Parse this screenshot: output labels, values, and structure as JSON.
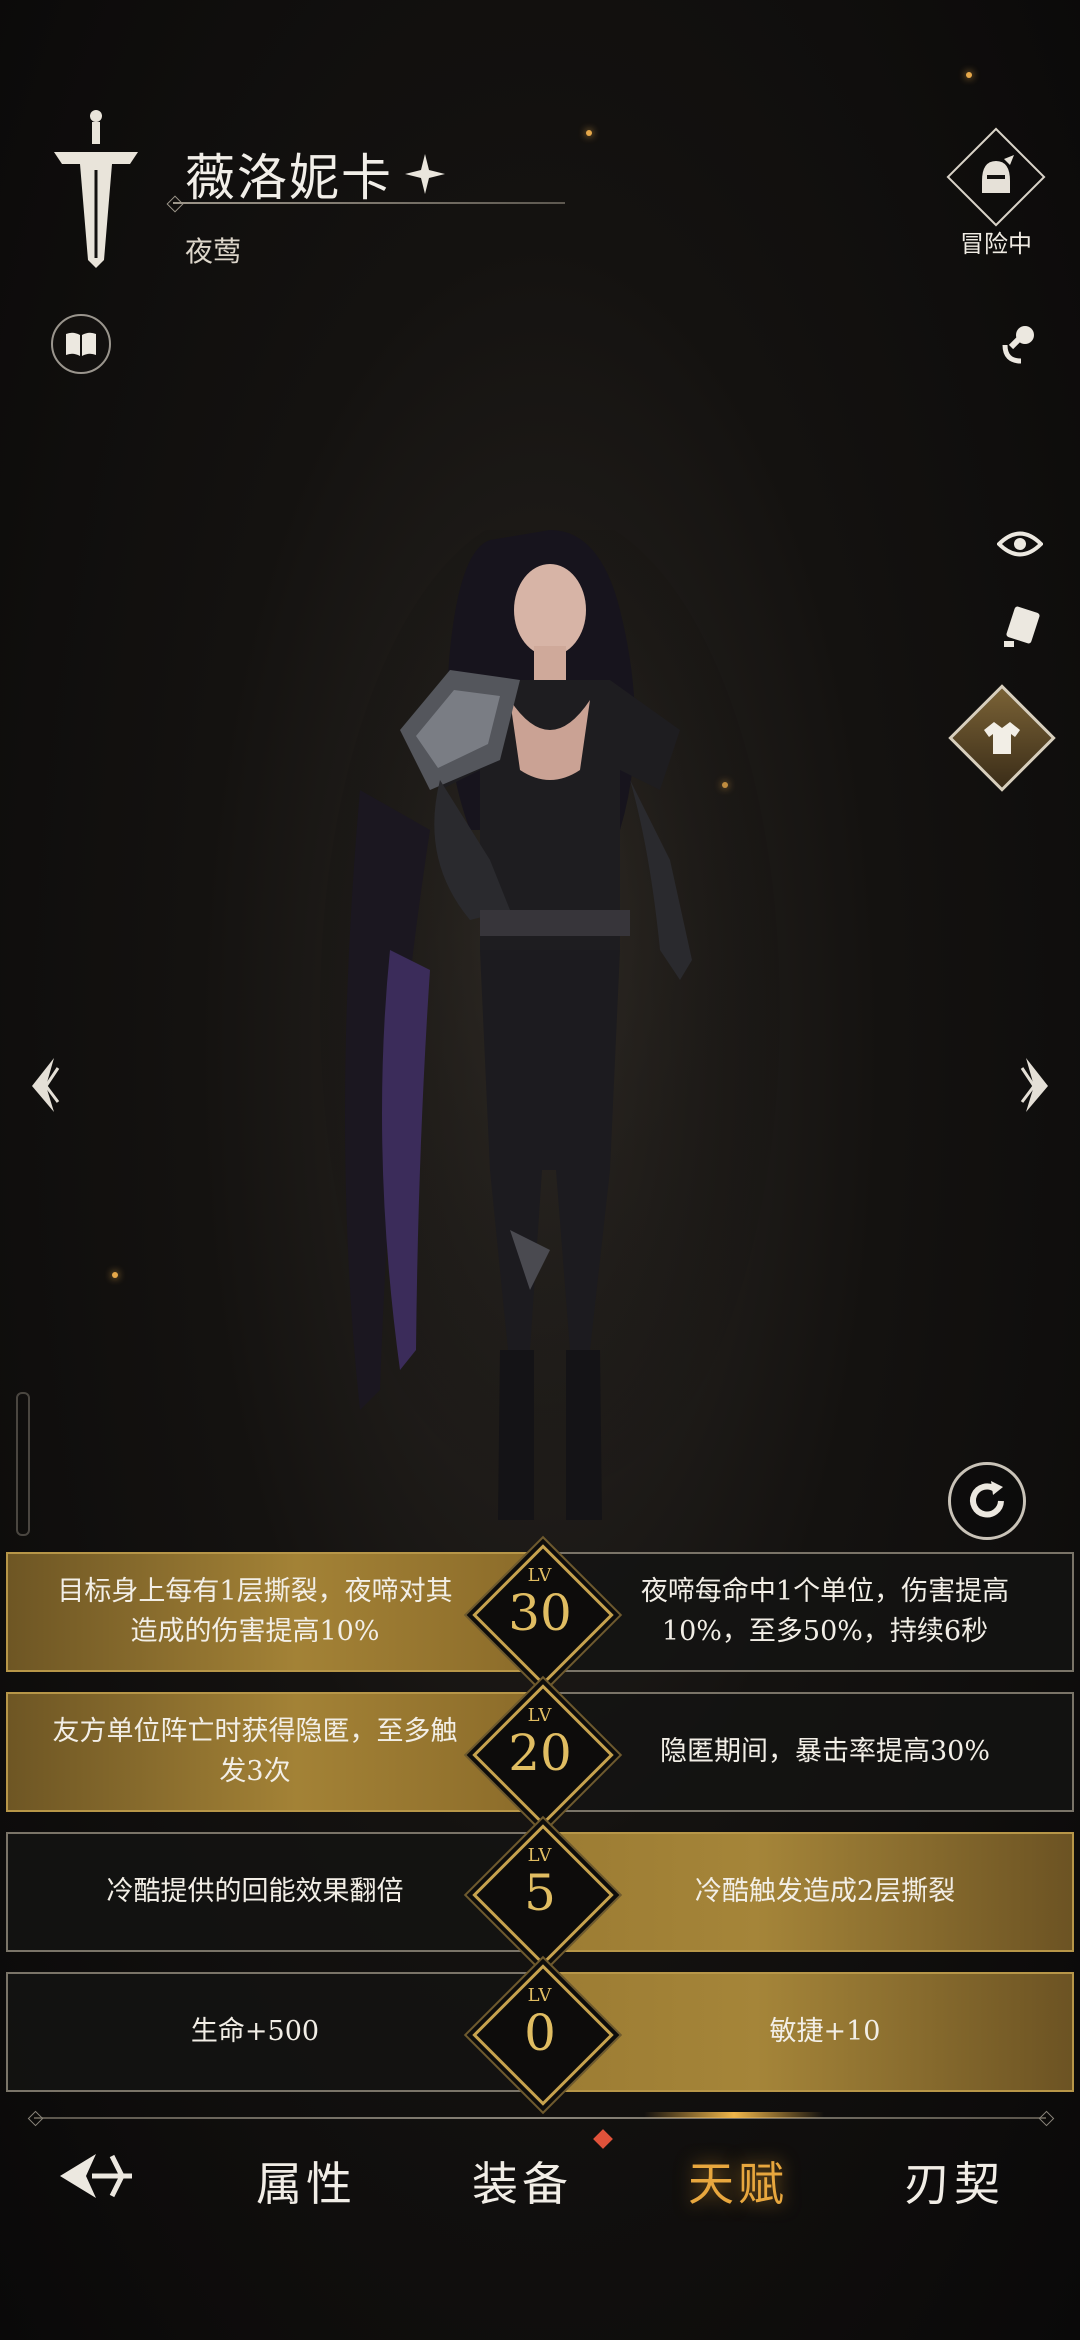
{
  "header": {
    "name": "薇洛妮卡",
    "subtitle": "夜莺",
    "status_label": "冒险中"
  },
  "icons": {
    "emblem": "sword-emblem-icon",
    "codex": "book-icon",
    "status": "helmet-icon",
    "voice": "microphone-icon",
    "view": "eye-icon",
    "card": "card-icon",
    "outfit": "shirt-icon",
    "prev": "arrow-left-icon",
    "next": "arrow-right-icon",
    "rotate": "refresh-icon",
    "back": "back-icon"
  },
  "talents": [
    {
      "level_label": "LV",
      "level": "30",
      "left": "目标身上每有1层撕裂，夜啼对其造成的伤害提高10%",
      "right": "夜啼每命中1个单位，伤害提高10%，至多50%，持续6秒",
      "selected": "left"
    },
    {
      "level_label": "LV",
      "level": "20",
      "left": "友方单位阵亡时获得隐匿，至多触发3次",
      "right": "隐匿期间，暴击率提高30%",
      "selected": "left"
    },
    {
      "level_label": "LV",
      "level": "5",
      "left": "冷酷提供的回能效果翻倍",
      "right": "冷酷触发造成2层撕裂",
      "selected": "right"
    },
    {
      "level_label": "LV",
      "level": "0",
      "left": "生命+500",
      "right": "敏捷+10",
      "selected": "right"
    }
  ],
  "tabs": {
    "attributes": "属性",
    "equipment": "装备",
    "talent": "天赋",
    "blade_pact": "刃契",
    "active": "天赋"
  },
  "colors": {
    "accent_gold": "#e8a73e",
    "selected_fill": "#a38236",
    "notification": "#e0523a"
  }
}
